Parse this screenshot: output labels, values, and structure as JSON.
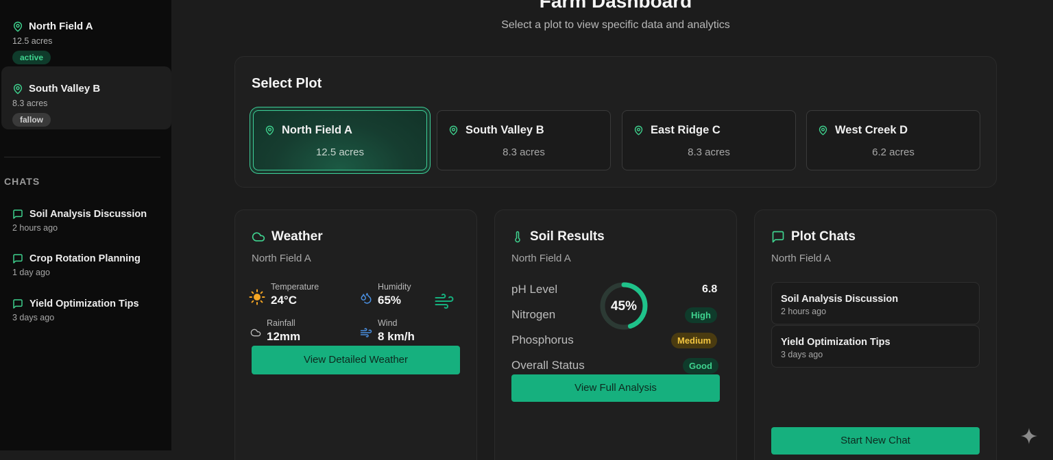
{
  "sidebar": {
    "plots": [
      {
        "name": "North Field A",
        "acres": "12.5 acres",
        "status": "active"
      },
      {
        "name": "South Valley B",
        "acres": "8.3 acres",
        "status": "fallow"
      }
    ],
    "chats_heading": "CHATS",
    "chats": [
      {
        "title": "Soil Analysis Discussion",
        "time": "2 hours ago"
      },
      {
        "title": "Crop Rotation Planning",
        "time": "1 day ago"
      },
      {
        "title": "Yield Optimization Tips",
        "time": "3 days ago"
      }
    ]
  },
  "header": {
    "title": "Farm Dashboard",
    "subtitle": "Select a plot to view specific data and analytics"
  },
  "select_plot": {
    "title": "Select Plot",
    "selected": "North Field A",
    "plots": [
      {
        "name": "North Field A",
        "acres": "12.5 acres"
      },
      {
        "name": "South Valley B",
        "acres": "8.3 acres"
      },
      {
        "name": "East Ridge C",
        "acres": "8.3 acres"
      },
      {
        "name": "West Creek D",
        "acres": "6.2 acres"
      }
    ]
  },
  "weather": {
    "title": "Weather",
    "plot": "North Field A",
    "temperature_label": "Temperature",
    "temperature": "24°C",
    "humidity_label": "Humidity",
    "humidity": "65%",
    "rainfall_label": "Rainfall",
    "rainfall": "12mm",
    "wind_label": "Wind",
    "wind": "8 km/h",
    "button": "View Detailed Weather"
  },
  "soil": {
    "title": "Soil Results",
    "plot": "North Field A",
    "ph_label": "pH Level",
    "ph_value": "6.8",
    "nitrogen_label": "Nitrogen",
    "nitrogen_value": "High",
    "phosphorus_label": "Phosphorus",
    "phosphorus_value": "Medium",
    "overall_label": "Overall Status",
    "overall_value": "Good",
    "gauge_text": "45%",
    "gauge_fraction": 0.45,
    "button": "View Full Analysis"
  },
  "plot_chats": {
    "title": "Plot Chats",
    "plot": "North Field A",
    "chats": [
      {
        "title": "Soil Analysis Discussion",
        "time": "2 hours ago"
      },
      {
        "title": "Yield Optimization Tips",
        "time": "3 days ago"
      }
    ],
    "button": "Start New Chat"
  },
  "colors": {
    "accent": "#16b07e",
    "accent_light": "#3fd38f",
    "medium": "#f2c540",
    "background": "#1c1c1c",
    "sidebar": "#0c0c0c"
  },
  "icons": {
    "plot": "map-pin-icon",
    "chat": "message-square-icon",
    "weather": "cloud-icon",
    "soil": "thermometer-icon",
    "sun": "sun-icon",
    "humidity": "droplets-icon",
    "rain": "cloud-icon",
    "wind": "wind-icon",
    "corner": "sparkle-icon"
  }
}
